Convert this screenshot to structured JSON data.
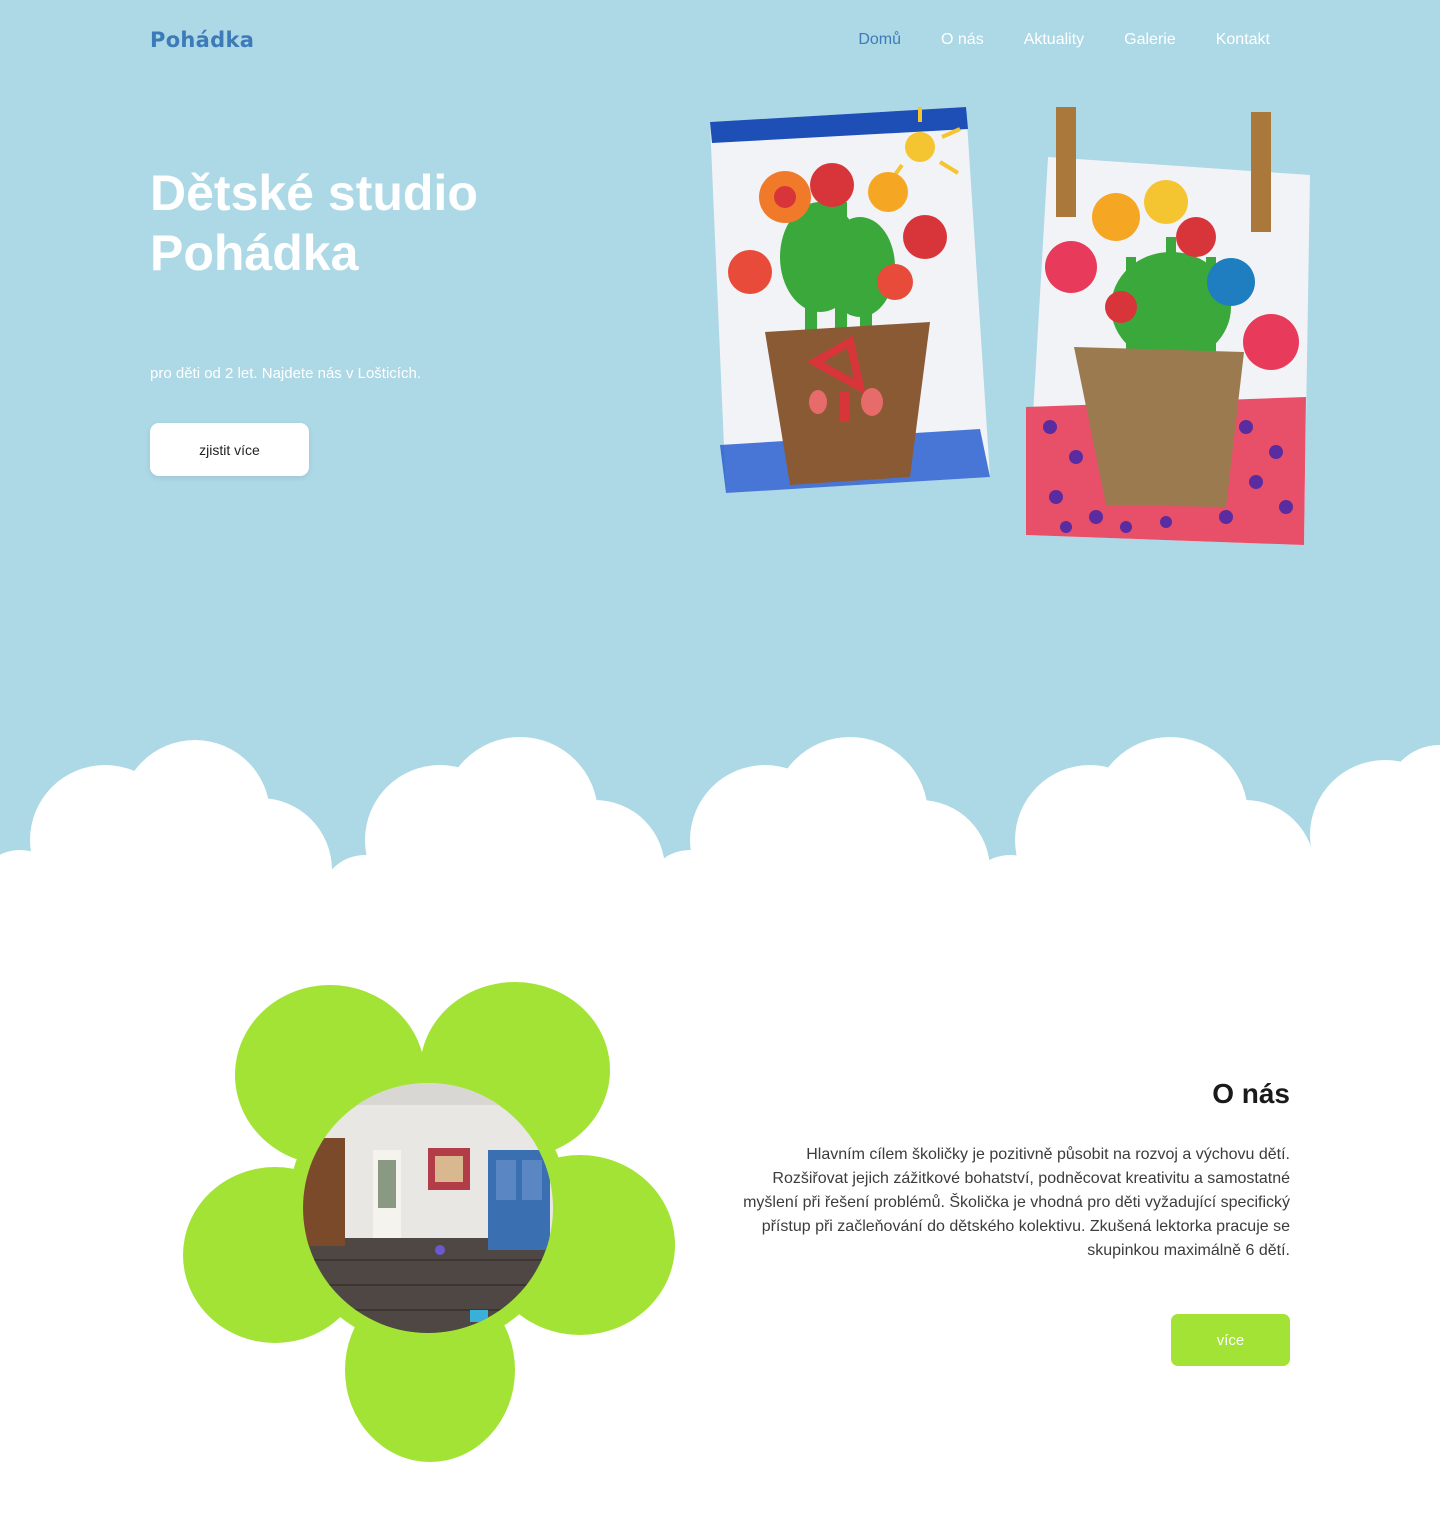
{
  "header": {
    "logo": "Pohádka",
    "nav": [
      {
        "label": "Domů",
        "active": true
      },
      {
        "label": "O nás",
        "active": false
      },
      {
        "label": "Aktuality",
        "active": false
      },
      {
        "label": "Galerie",
        "active": false
      },
      {
        "label": "Kontakt",
        "active": false
      }
    ]
  },
  "hero": {
    "title": "Dětské studio Pohádka",
    "subtitle": "pro děti od 2 let. Najdete nás v Lošticích.",
    "button_label": "zjistit více"
  },
  "about": {
    "title": "O nás",
    "text": "Hlavním cílem školičky je pozitivně působit na rozvoj a výchovu dětí. Rozšiřovat jejich zážitkové bohatství, podněcovat kreativitu a samostatné myšlení při řešení problémů. Školička je vhodná pro děti vyžadující specifický přístup při začleňování do dětského kolektivu. Zkušená lektorka pracuje se skupinkou maximálně 6 dětí.",
    "button_label": "více"
  },
  "colors": {
    "sky": "#add8e6",
    "logo_blue": "#3d7bb8",
    "flower_green": "#a2e336"
  }
}
